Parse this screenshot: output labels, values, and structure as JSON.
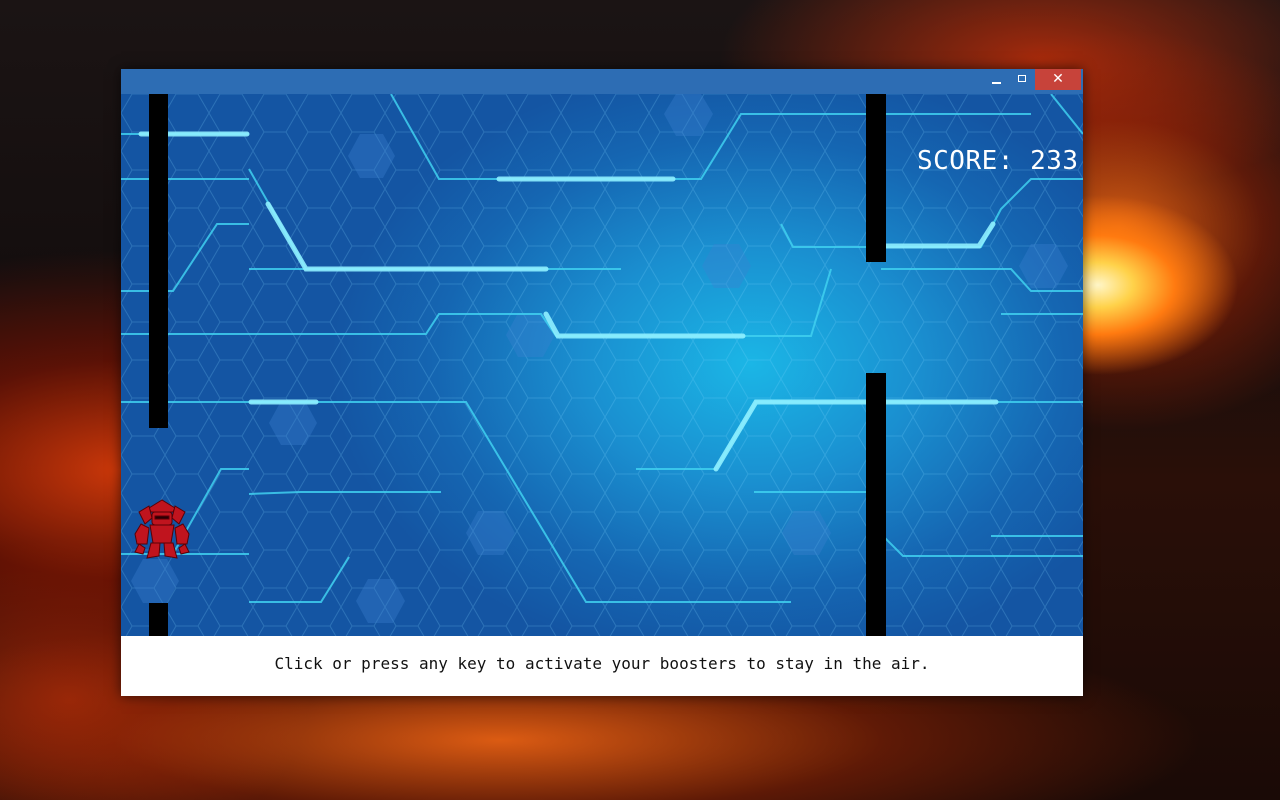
{
  "window": {
    "controls": {
      "minimize_icon": "minimize-icon",
      "maximize_icon": "maximize-icon",
      "close_icon": "close-icon",
      "close_glyph": "✕"
    }
  },
  "game": {
    "score_text": "SCORE: 233",
    "instructions": "Click or press any key to activate your boosters to stay in the air.",
    "player_icon": "robot-icon",
    "background": "circuit-hexagon-pattern"
  },
  "colors": {
    "title_bar": "#2d6db4",
    "close_button": "#c7433a",
    "game_bg_center": "#1bb6e6",
    "game_bg_edge": "#1455a3",
    "circuit_line": "#3fd0f0",
    "pillar": "#000000",
    "robot": "#c0141e",
    "score_text": "#ffffff"
  }
}
